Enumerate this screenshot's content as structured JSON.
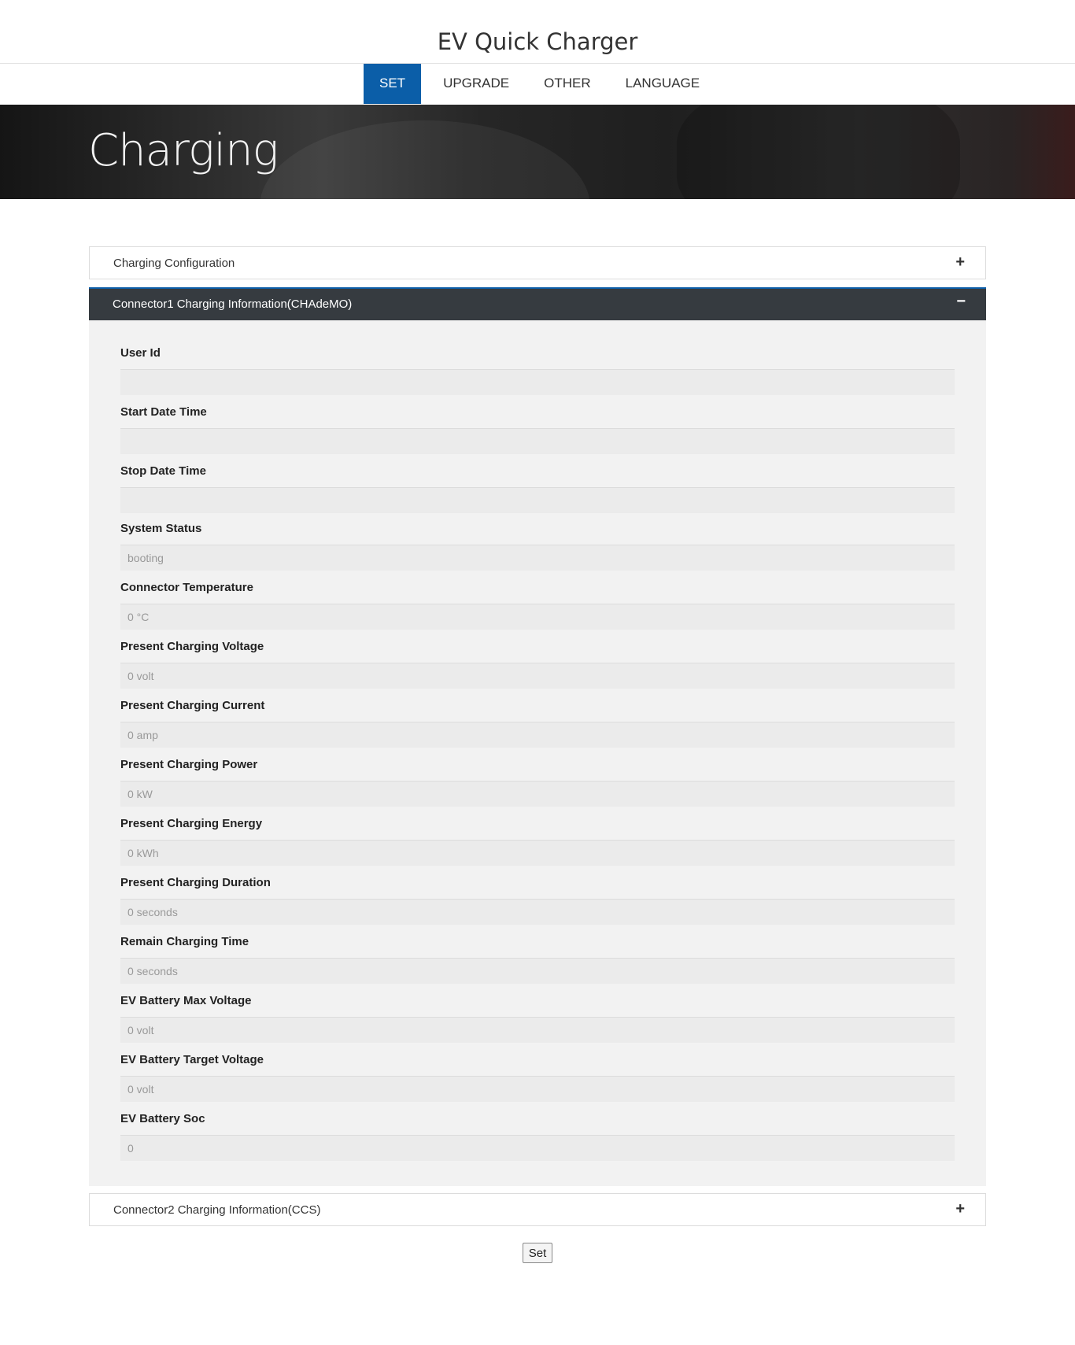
{
  "header": {
    "title": "EV Quick Charger"
  },
  "nav": {
    "items": [
      {
        "label": "SET",
        "active": true
      },
      {
        "label": "UPGRADE",
        "active": false
      },
      {
        "label": "OTHER",
        "active": false
      },
      {
        "label": "LANGUAGE",
        "active": false
      }
    ]
  },
  "hero": {
    "title": "Charging"
  },
  "panels": {
    "config": {
      "title": "Charging Configuration",
      "toggle": "+"
    },
    "connector1": {
      "title": "Connector1 Charging Information(CHAdeMO)",
      "toggle": "−"
    },
    "connector2": {
      "title": "Connector2 Charging Information(CCS)",
      "toggle": "+"
    }
  },
  "fields": [
    {
      "label": "User Id",
      "value": ""
    },
    {
      "label": "Start Date Time",
      "value": ""
    },
    {
      "label": "Stop Date Time",
      "value": ""
    },
    {
      "label": "System Status",
      "value": "booting"
    },
    {
      "label": "Connector Temperature",
      "value": "0 °C"
    },
    {
      "label": "Present Charging Voltage",
      "value": "0 volt"
    },
    {
      "label": "Present Charging Current",
      "value": "0 amp"
    },
    {
      "label": "Present Charging Power",
      "value": "0 kW"
    },
    {
      "label": "Present Charging Energy",
      "value": "0 kWh"
    },
    {
      "label": "Present Charging Duration",
      "value": "0 seconds"
    },
    {
      "label": "Remain Charging Time",
      "value": "0 seconds"
    },
    {
      "label": "EV Battery Max Voltage",
      "value": "0 volt"
    },
    {
      "label": "EV Battery Target Voltage",
      "value": "0 volt"
    },
    {
      "label": "EV Battery Soc",
      "value": "0"
    }
  ],
  "actions": {
    "set_label": "Set"
  },
  "colors": {
    "accent": "#0b5ea8",
    "panel_open": "#363b40",
    "body_bg": "#f2f2f2"
  }
}
